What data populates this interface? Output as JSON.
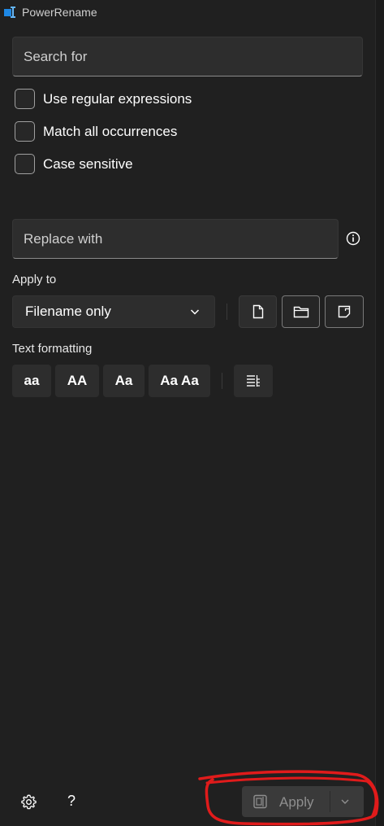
{
  "window": {
    "title": "PowerRename"
  },
  "search": {
    "placeholder": "Search for"
  },
  "options": [
    {
      "label": "Use regular expressions",
      "checked": false
    },
    {
      "label": "Match all occurrences",
      "checked": false
    },
    {
      "label": "Case sensitive",
      "checked": false
    }
  ],
  "replace": {
    "placeholder": "Replace with"
  },
  "apply_to": {
    "label": "Apply to",
    "selected": "Filename only",
    "scope_buttons": [
      "file-icon",
      "folder-icon",
      "subfolder-icon"
    ]
  },
  "text_formatting": {
    "label": "Text formatting",
    "buttons": [
      "aa",
      "AA",
      "Aa",
      "Aa Aa"
    ],
    "enumerate_icon": "enumerate-list-icon"
  },
  "footer": {
    "settings_icon": "gear-icon",
    "help_label": "?",
    "apply_label": "Apply",
    "apply_enabled": false
  },
  "colors": {
    "background": "#202020",
    "control": "#2d2d2d",
    "accent_annotation": "#e01b1b",
    "app_icon": "#1e88e5"
  }
}
